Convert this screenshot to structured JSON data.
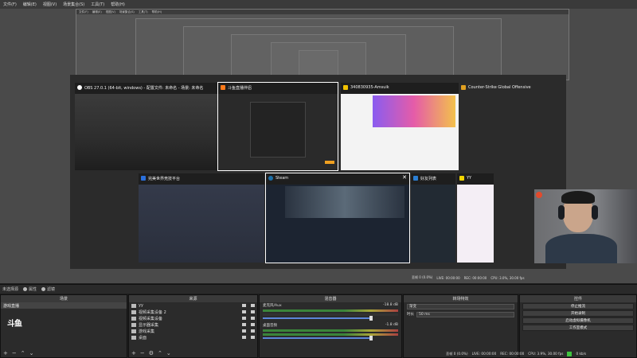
{
  "menubar": {
    "items": [
      "文件(F)",
      "编辑(E)",
      "视图(V)",
      "场景集合(S)",
      "工具(T)",
      "帮助(H)"
    ]
  },
  "nested_preview": {
    "items": [
      "文件(F)",
      "编辑(E)",
      "视图(V)",
      "场景集合(S)",
      "工具(T)",
      "帮助(H)"
    ]
  },
  "switcher": {
    "tiles": [
      {
        "title": "OBS 27.0.1 (64-bit, windows) - 配置文件: 未命名 - 场景: 未命名",
        "icon_color": "#ffffff"
      },
      {
        "title": "斗鱼直播伴侣",
        "icon_color": "#ff7a1a",
        "selected": true
      },
      {
        "title": "340830935-Amsuik",
        "icon_color": "#f2c200"
      },
      {
        "title": "Counter-Strike Global Offensive",
        "icon_color": "#e0a020"
      },
      {
        "title": "完美世界竞技平台",
        "icon_color": "#2a6fdb"
      },
      {
        "title": "Steam",
        "icon_color": "#1b6fa8",
        "close": "✕"
      },
      {
        "title": "好友列表",
        "icon_color": "#2b7fd4"
      },
      {
        "title": "YY",
        "icon_color": "#f2d500"
      }
    ]
  },
  "preview_status": [
    "丢帧 0 (0.0%)",
    "LIVE: 00:00:00",
    "REC: 00:00:00",
    "CPU: 3.0%, 30.00 fps"
  ],
  "scene_strip": {
    "label": "未选择源",
    "props": "属性",
    "filters": "滤镜"
  },
  "scenes": {
    "header": "场景",
    "selected": "游戏直播",
    "logo_text": "斗鱼"
  },
  "sources": {
    "header": "来源",
    "items": [
      "yy",
      "视频采集设备 2",
      "视频采集设备",
      "显示器采集",
      "游戏采集",
      "桌面"
    ]
  },
  "mixer": {
    "header": "混音器",
    "channels": [
      {
        "name": "麦克风/Aux",
        "db": "-18.8 dB"
      },
      {
        "name": "桌面音频",
        "db": "-1.8 dB"
      }
    ]
  },
  "transitions": {
    "header": "转场特效",
    "type": "渐变",
    "duration_label": "时长",
    "duration_value": "50 ms"
  },
  "controls": {
    "header": "控件",
    "buttons": [
      "停止推流",
      "开始录制",
      "启动虚拟摄像机",
      "工作室模式"
    ]
  },
  "statusbar": [
    "丢帧 0 (0.0%)",
    "LIVE: 00:00:00",
    "REC: 00:00:00",
    "CPU: 3.9%, 30.00 fps",
    "0 kb/s"
  ],
  "colors": {
    "accent": "#5b85d8",
    "live_green": "#3fc43f",
    "selected_outline": "#ffffff"
  }
}
